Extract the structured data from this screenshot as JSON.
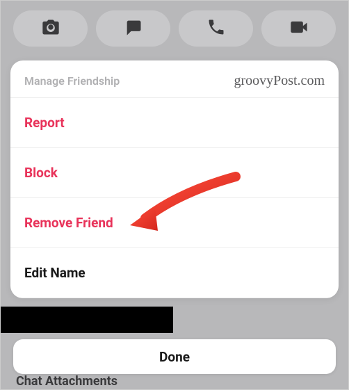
{
  "sheet": {
    "title": "Manage Friendship",
    "watermark": "groovyPost.com",
    "items": [
      {
        "label": "Report",
        "style": "danger"
      },
      {
        "label": "Block",
        "style": "danger"
      },
      {
        "label": "Remove Friend",
        "style": "danger"
      },
      {
        "label": "Edit Name",
        "style": "normal"
      }
    ]
  },
  "done": {
    "label": "Done"
  },
  "background": {
    "peek_label": "Chat Attachments"
  }
}
